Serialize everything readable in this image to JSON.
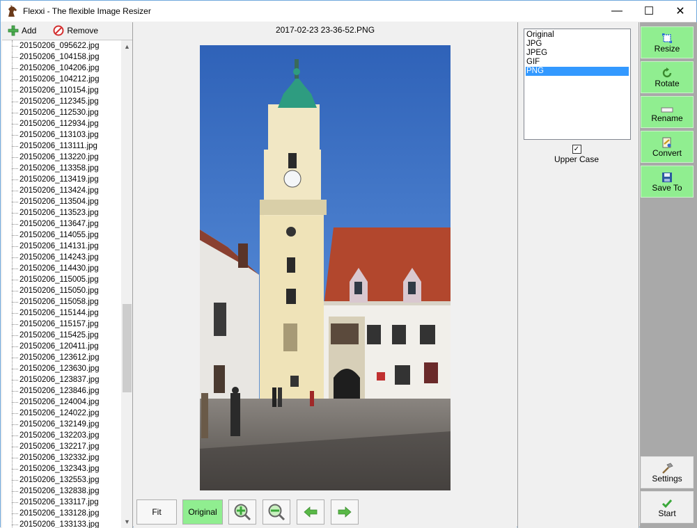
{
  "window": {
    "title": "Flexxi - The flexible Image Resizer",
    "controls": {
      "minimize": "—",
      "maximize": "☐",
      "close": "✕"
    }
  },
  "toolbar": {
    "add_label": "Add",
    "remove_label": "Remove"
  },
  "files": [
    "20150206_095622.jpg",
    "20150206_104158.jpg",
    "20150206_104206.jpg",
    "20150206_104212.jpg",
    "20150206_110154.jpg",
    "20150206_112345.jpg",
    "20150206_112530.jpg",
    "20150206_112934.jpg",
    "20150206_113103.jpg",
    "20150206_113111.jpg",
    "20150206_113220.jpg",
    "20150206_113358.jpg",
    "20150206_113419.jpg",
    "20150206_113424.jpg",
    "20150206_113504.jpg",
    "20150206_113523.jpg",
    "20150206_113647.jpg",
    "20150206_114055.jpg",
    "20150206_114131.jpg",
    "20150206_114243.jpg",
    "20150206_114430.jpg",
    "20150206_115005.jpg",
    "20150206_115050.jpg",
    "20150206_115058.jpg",
    "20150206_115144.jpg",
    "20150206_115157.jpg",
    "20150206_115425.jpg",
    "20150206_120411.jpg",
    "20150206_123612.jpg",
    "20150206_123630.jpg",
    "20150206_123837.jpg",
    "20150206_123846.jpg",
    "20150206_124004.jpg",
    "20150206_124022.jpg",
    "20150206_132149.jpg",
    "20150206_132203.jpg",
    "20150206_132217.jpg",
    "20150206_132332.jpg",
    "20150206_132343.jpg",
    "20150206_132553.jpg",
    "20150206_132838.jpg",
    "20150206_133117.jpg",
    "20150206_133128.jpg",
    "20150206_133133.jpg"
  ],
  "preview": {
    "filename": "2017-02-23 23-36-52.PNG"
  },
  "view_buttons": {
    "fit": "Fit",
    "original": "Original",
    "zoom_in_icon": "zoom-in-icon",
    "zoom_out_icon": "zoom-out-icon",
    "prev_icon": "arrow-left-icon",
    "next_icon": "arrow-right-icon"
  },
  "formats": {
    "items": [
      "Original",
      "JPG",
      "JPEG",
      "GIF",
      "PNG"
    ],
    "selected": "PNG"
  },
  "upper_case": {
    "label": "Upper Case",
    "checked": true,
    "mark": "✓"
  },
  "actions": {
    "resize": "Resize",
    "rotate": "Rotate",
    "rename": "Rename",
    "convert": "Convert",
    "save_to": "Save To",
    "settings": "Settings",
    "start": "Start"
  },
  "colors": {
    "accent_green": "#90ee90",
    "selection_blue": "#3399ff",
    "action_column": "#a9a9a9"
  }
}
